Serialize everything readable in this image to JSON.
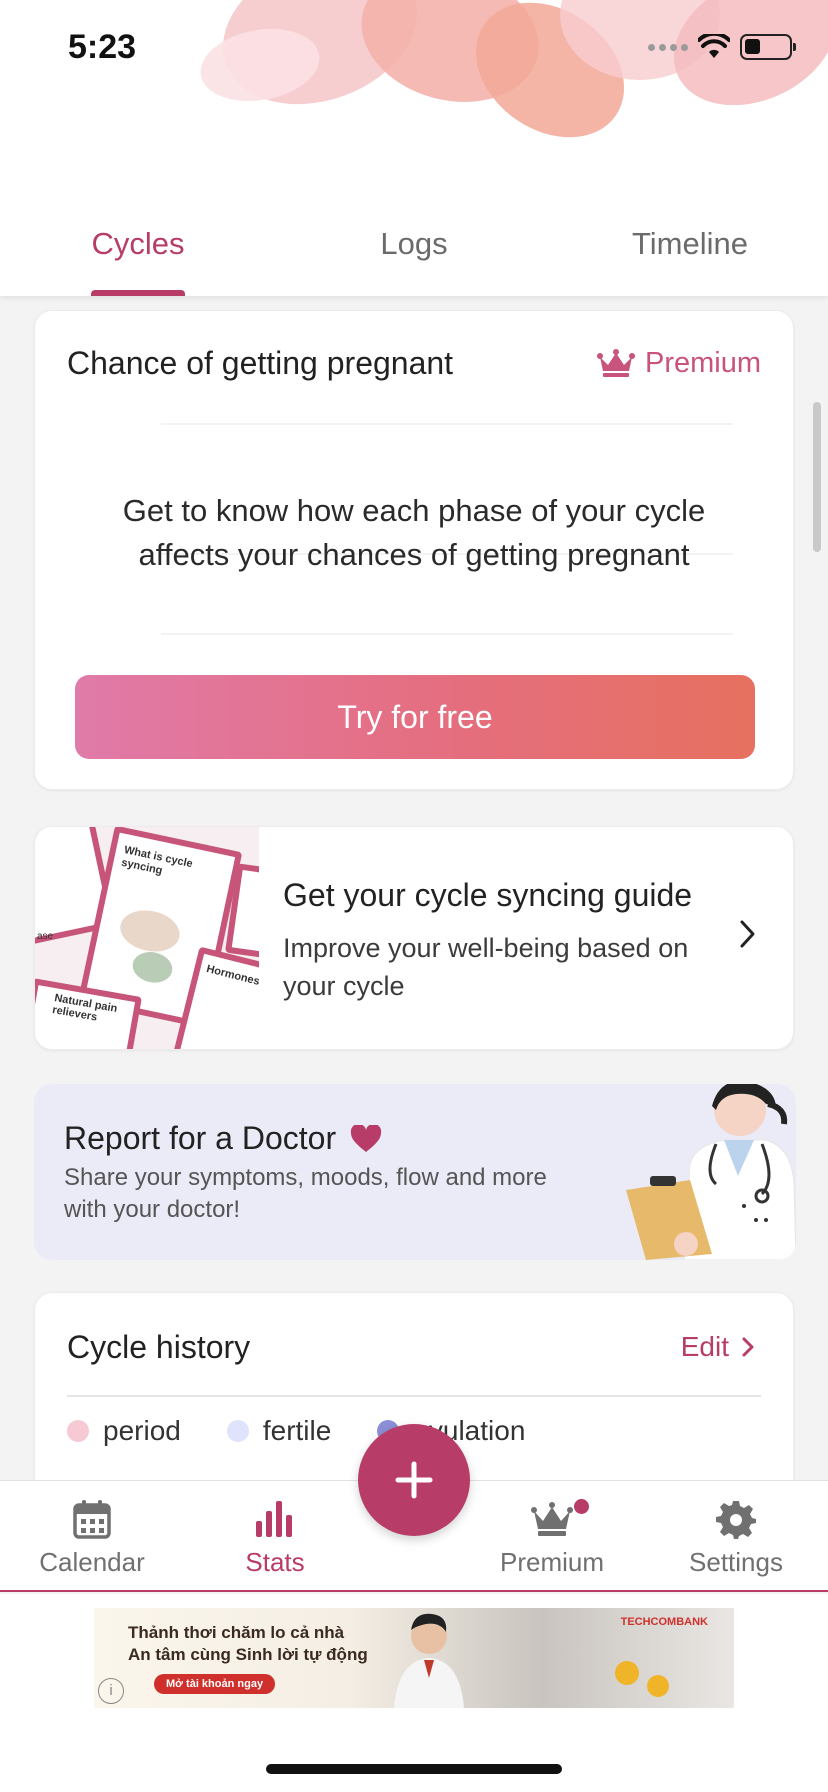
{
  "status_bar": {
    "time": "5:23"
  },
  "tabs": [
    {
      "label": "Cycles",
      "active": true
    },
    {
      "label": "Logs",
      "active": false
    },
    {
      "label": "Timeline",
      "active": false
    }
  ],
  "pregnancy_card": {
    "title": "Chance of getting pregnant",
    "premium_label": "Premium",
    "description": "Get to know how each phase of your cycle affects your chances of getting pregnant",
    "button_label": "Try for free"
  },
  "guide_card": {
    "title": "Get your cycle syncing guide",
    "subtitle": "Improve your well-being based on your cycle",
    "image_texts": [
      "What is cycle syncing",
      "Hormones",
      "Natural pain relievers",
      "ase"
    ]
  },
  "report_card": {
    "title": "Report for a Doctor",
    "subtitle": "Share your symptoms, moods, flow and more with your doctor!"
  },
  "history_card": {
    "title": "Cycle history",
    "edit_label": "Edit",
    "legend": [
      {
        "label": "period",
        "color": "#f7c9d3"
      },
      {
        "label": "fertile",
        "color": "#dfe3fb"
      },
      {
        "label": "ovulation",
        "color": "#8a8fd6"
      }
    ]
  },
  "bottom_nav": {
    "items": [
      {
        "label": "Calendar",
        "icon": "calendar-icon",
        "active": false
      },
      {
        "label": "Stats",
        "icon": "stats-icon",
        "active": true
      },
      {
        "label": "Premium",
        "icon": "crown-icon",
        "active": false
      },
      {
        "label": "Settings",
        "icon": "gear-icon",
        "active": false
      }
    ],
    "fab_icon": "plus-icon"
  },
  "ad": {
    "line1": "Thảnh thơi chăm lo cả nhà",
    "line2": "An tâm cùng Sinh lời tự động",
    "cta": "Mở tài khoản ngay",
    "brand": "TECHCOMBANK"
  },
  "colors": {
    "accent": "#b83c68",
    "premium": "#c8537c",
    "button_gradient": [
      "#e07aa8",
      "#e6715f"
    ],
    "report_bg": "#ebeaf7"
  }
}
